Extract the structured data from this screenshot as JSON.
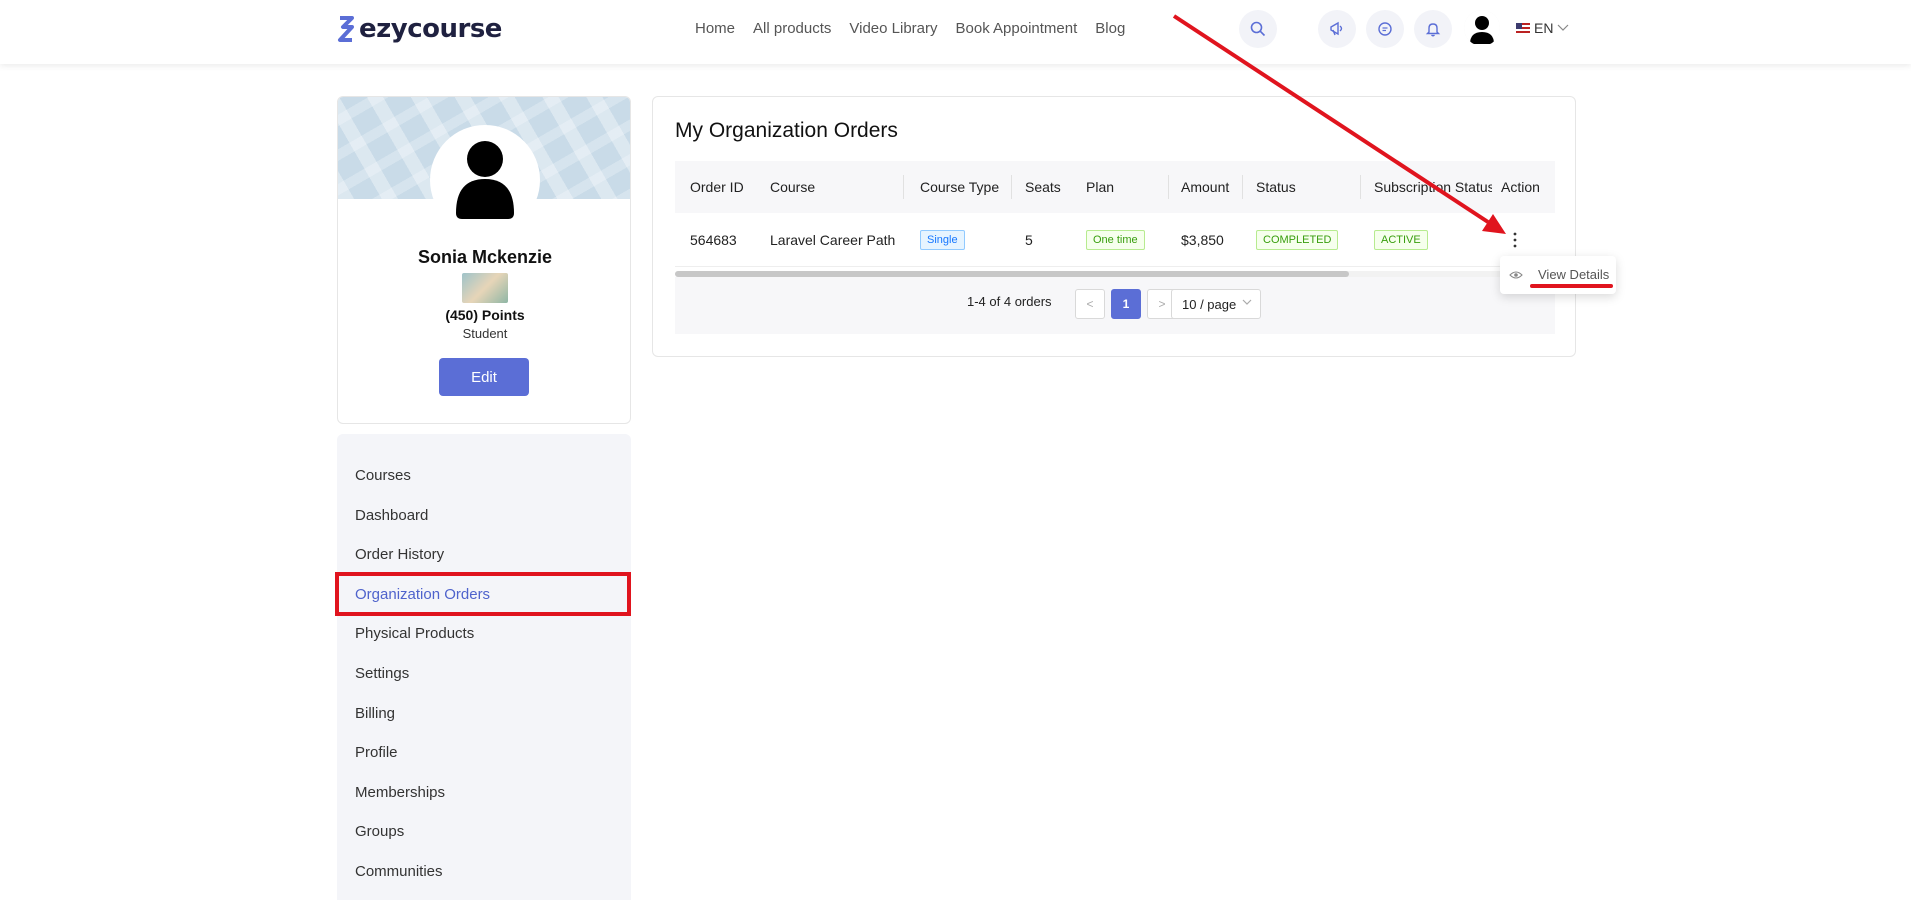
{
  "header": {
    "logo_text": "ezycourse",
    "nav": [
      "Home",
      "All products",
      "Video Library",
      "Book Appointment",
      "Blog"
    ],
    "language": "EN",
    "icons": [
      "search-icon",
      "megaphone-icon",
      "chat-icon",
      "bell-icon",
      "user-avatar-icon",
      "us-flag-icon"
    ]
  },
  "profile": {
    "name": "Sonia Mckenzie",
    "points": "(450) Points",
    "role": "Student",
    "edit_label": "Edit"
  },
  "sidebar": {
    "items": [
      {
        "label": "Courses"
      },
      {
        "label": "Dashboard"
      },
      {
        "label": "Order History"
      },
      {
        "label": "Organization Orders",
        "active": true
      },
      {
        "label": "Physical Products"
      },
      {
        "label": "Settings"
      },
      {
        "label": "Billing"
      },
      {
        "label": "Profile"
      },
      {
        "label": "Memberships"
      },
      {
        "label": "Groups"
      },
      {
        "label": "Communities"
      }
    ]
  },
  "orders": {
    "title": "My Organization Orders",
    "columns": [
      "Order ID",
      "Course",
      "Course Type",
      "Seats",
      "Plan",
      "Amount",
      "Status",
      "Subscription Status",
      "Action"
    ],
    "rows": [
      {
        "order_id": "564683",
        "course": "Laravel Career Path",
        "course_type": "Single",
        "seats": "5",
        "plan": "One time",
        "amount": "$3,850",
        "status": "COMPLETED",
        "subscription_status": "ACTIVE"
      }
    ],
    "pagination": {
      "total_text": "1-4 of 4 orders",
      "current_page": "1",
      "prev": "<",
      "next": ">",
      "page_size": "10 / page"
    },
    "action_menu": {
      "view_details": "View Details"
    }
  },
  "colors": {
    "accent": "#5b6ed6",
    "annotation_red": "#e0141e",
    "active_menu": "#4f63cc"
  }
}
